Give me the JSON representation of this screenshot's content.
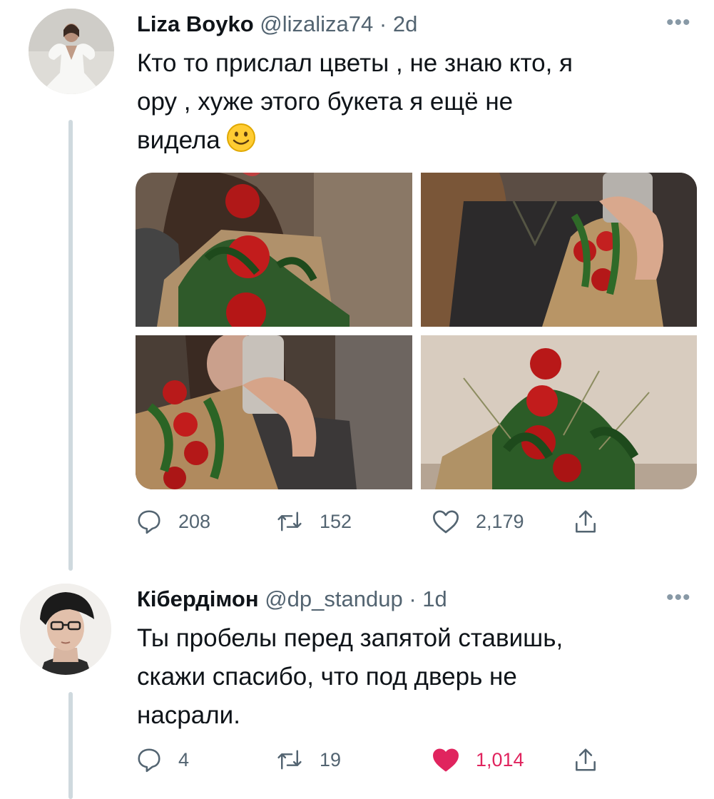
{
  "tweets": [
    {
      "author": {
        "name": "Liza Boyko",
        "handle": "@lizaliza74",
        "time": "2d"
      },
      "more_icon": "more-dots-icon",
      "text_lines": [
        "Кто то прислал цветы , не знаю кто, я",
        "ору , хуже этого букета я ещё не",
        "видела"
      ],
      "emoji": "slightly-smiling-face-emoji",
      "media_count": 4,
      "actions": {
        "replies": "208",
        "retweets": "152",
        "likes": "2,179",
        "liked": false
      }
    },
    {
      "author": {
        "name": "Кібердімон",
        "handle": "@dp_standup",
        "time": "1d"
      },
      "more_icon": "more-dots-icon",
      "text_lines": [
        "Ты пробелы перед запятой ставишь,",
        "скажи спасибо, что под дверь не",
        "насрали."
      ],
      "actions": {
        "replies": "4",
        "retweets": "19",
        "likes": "1,014",
        "liked": true
      }
    }
  ],
  "colors": {
    "text": "#0f1419",
    "secondary": "#536471",
    "thread_line": "#cfd9de",
    "like_active": "#e0245e"
  }
}
